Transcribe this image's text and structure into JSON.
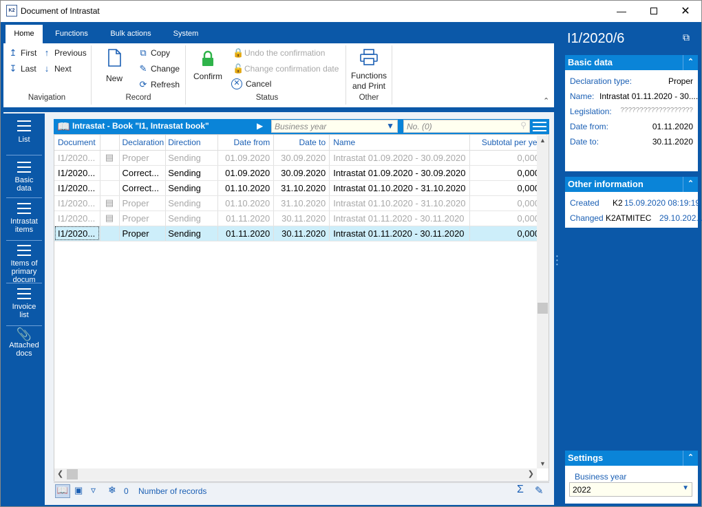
{
  "window": {
    "title": "Document of Intrastat",
    "logo": "K2",
    "minimize_icon": "minimize-icon",
    "maximize_icon": "maximize-icon",
    "close_icon": "close-icon"
  },
  "ribbon": {
    "tabs": [
      "Home",
      "Functions",
      "Bulk actions",
      "System"
    ],
    "active_tab": "Home",
    "navigation": {
      "first": "First",
      "previous": "Previous",
      "last": "Last",
      "next": "Next",
      "label": "Navigation"
    },
    "record": {
      "new": "New",
      "copy": "Copy",
      "change": "Change",
      "refresh": "Refresh",
      "label": "Record"
    },
    "status": {
      "confirm": "Confirm",
      "undo": "Undo the confirmation",
      "change_date": "Change confirmation date",
      "cancel": "Cancel",
      "label": "Status"
    },
    "other": {
      "functions_line1": "Functions",
      "functions_line2": "and Print",
      "label": "Other"
    }
  },
  "left_tabs": [
    {
      "l1": "List",
      "l2": ""
    },
    {
      "l1": "Basic",
      "l2": "data"
    },
    {
      "l1": "Intrastat",
      "l2": "items"
    },
    {
      "l1": "Items of",
      "l2": "primary",
      "l3": "docum"
    },
    {
      "l1": "Invoice",
      "l2": "list"
    },
    {
      "l1": "Attached",
      "l2": "docs"
    }
  ],
  "grid": {
    "book_title": "Intrastat - Book \"I1, Intrastat book\"",
    "year_placeholder": "Business year",
    "no_placeholder": "No. (0)",
    "columns": [
      "Document",
      "",
      "Declaration",
      "Direction",
      "Date from",
      "Date to",
      "Name",
      "Subtotal per year"
    ],
    "rows": [
      {
        "doc": "I1/2020...",
        "decl": "Proper",
        "dir": "Sending",
        "from": "01.09.2020",
        "to": "30.09.2020",
        "name": "Intrastat 01.09.2020 - 30.09.2020",
        "sub": "0,0000"
      },
      {
        "doc": "I1/2020...",
        "decl": "Correct...",
        "dir": "Sending",
        "from": "01.09.2020",
        "to": "30.09.2020",
        "name": "Intrastat 01.09.2020 - 30.09.2020",
        "sub": "0,0000"
      },
      {
        "doc": "I1/2020...",
        "decl": "Correct...",
        "dir": "Sending",
        "from": "01.10.2020",
        "to": "31.10.2020",
        "name": "Intrastat 01.10.2020 - 31.10.2020",
        "sub": "0,0000"
      },
      {
        "doc": "I1/2020...",
        "decl": "Proper",
        "dir": "Sending",
        "from": "01.10.2020",
        "to": "31.10.2020",
        "name": "Intrastat 01.10.2020 - 31.10.2020",
        "sub": "0,0000"
      },
      {
        "doc": "I1/2020...",
        "decl": "Proper",
        "dir": "Sending",
        "from": "01.11.2020",
        "to": "30.11.2020",
        "name": "Intrastat 01.11.2020 - 30.11.2020",
        "sub": "0,0000"
      },
      {
        "doc": "I1/2020...",
        "decl": "Proper",
        "dir": "Sending",
        "from": "01.11.2020",
        "to": "30.11.2020",
        "name": "Intrastat 01.11.2020 - 30.11.2020",
        "sub": "0,0000"
      }
    ],
    "status": {
      "count": "0",
      "records_label": "Number of records"
    }
  },
  "right_panel": {
    "doc_id": "I1/2020/6",
    "basic": {
      "title": "Basic data",
      "decl_type_label": "Declaration type:",
      "decl_type": "Proper",
      "name_label": "Name:",
      "name": "Intrastat 01.11.2020 - 30....",
      "legislation_label": "Legislation:",
      "legislation": "???????????????????",
      "date_from_label": "Date from:",
      "date_from": "01.11.2020",
      "date_to_label": "Date to:",
      "date_to": "30.11.2020"
    },
    "other": {
      "title": "Other information",
      "created_label": "Created",
      "created_user": "K2",
      "created_at": "15.09.2020 08:19:19",
      "changed_label": "Changed",
      "changed_user": "K2ATMITEC",
      "changed_at": "29.10.202..."
    },
    "settings": {
      "title": "Settings",
      "year_label": "Business year",
      "year_value": "2022"
    }
  }
}
